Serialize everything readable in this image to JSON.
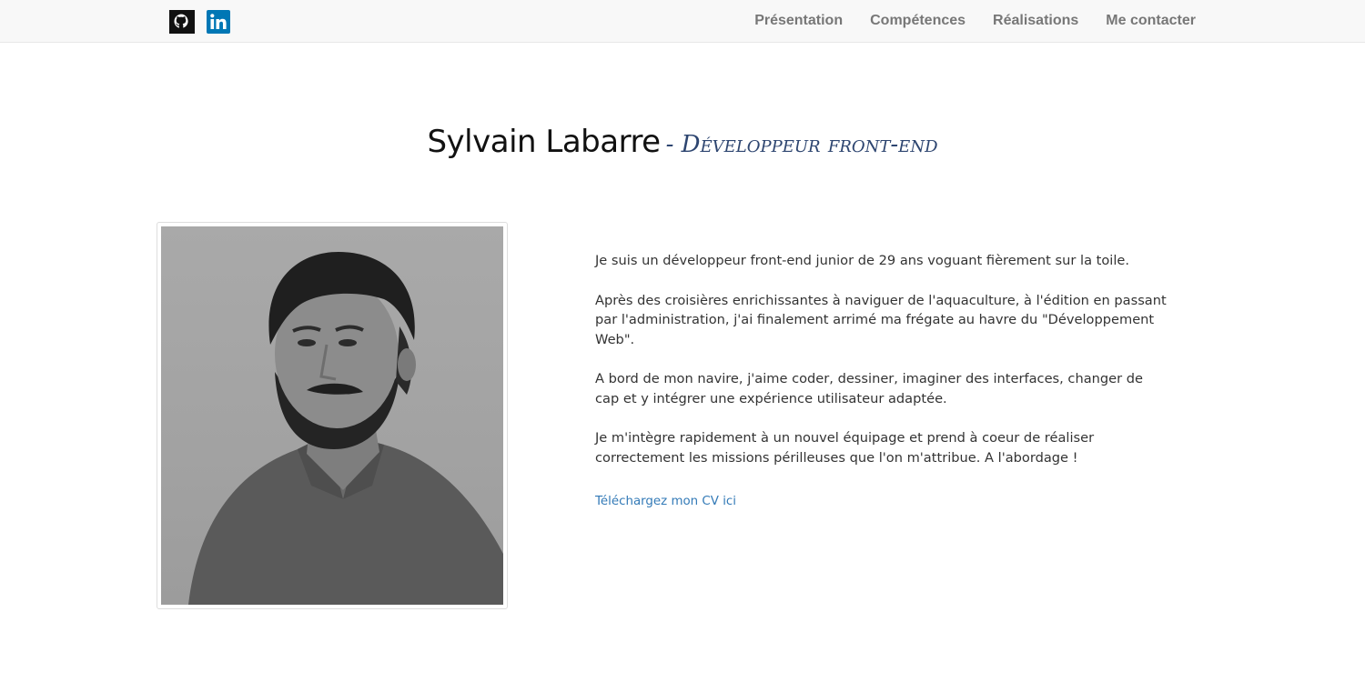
{
  "nav": {
    "social": [
      {
        "icon": "github-icon"
      },
      {
        "icon": "linkedin-icon"
      }
    ],
    "links": [
      {
        "label": "Présentation"
      },
      {
        "label": "Compétences"
      },
      {
        "label": "Réalisations"
      },
      {
        "label": "Me contacter"
      }
    ]
  },
  "header": {
    "name": "Sylvain Labarre",
    "role": "- Développeur front-end"
  },
  "bio": {
    "paragraphs": [
      "Je suis un développeur front-end junior de 29 ans voguant fièrement sur la toile.",
      "Après des croisières enrichissantes à naviguer de l'aquaculture, à l'édition en passant par l'administration, j'ai finalement arrimé ma frégate au havre du \"Développement Web\".",
      "A bord de mon navire, j'aime coder, dessiner, imaginer des interfaces, changer de cap et y intégrer une expérience utilisateur adaptée.",
      "Je m'intègre rapidement à un nouvel équipage et prend à coeur de réaliser correctement les missions périlleuses que l'on m'attribue. A l'abordage !"
    ],
    "cv_link": "Téléchargez mon CV ici"
  },
  "colors": {
    "nav_bg": "#f8f8f8",
    "nav_text": "#777777",
    "role_text": "#2d4570",
    "link": "#337ab7",
    "linkedin": "#0077b5"
  }
}
